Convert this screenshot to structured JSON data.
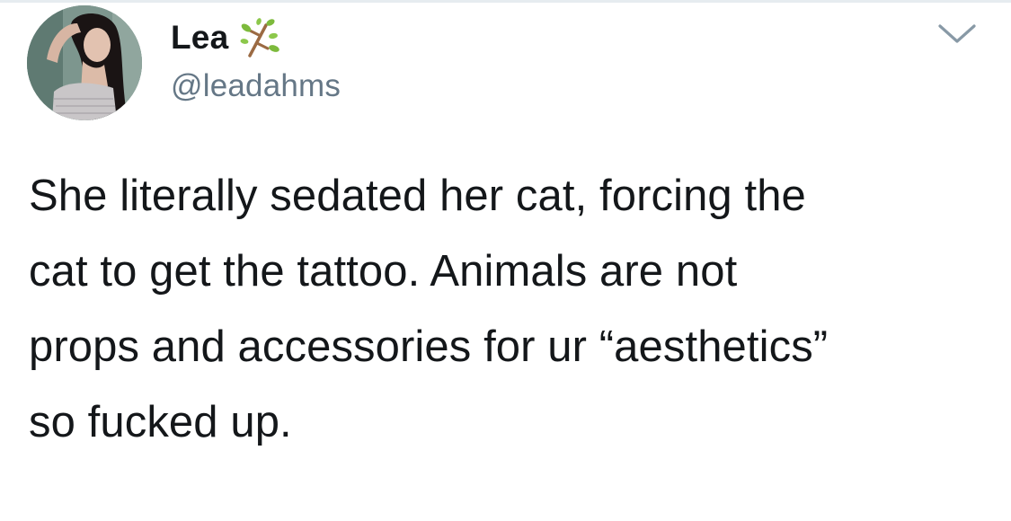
{
  "user": {
    "display_name": "Lea",
    "handle": "@leadahms",
    "name_emoji": "herb-icon"
  },
  "tweet": {
    "text": "She literally sedated her cat, forcing the\ncat to get the tattoo. Animals are not\nprops and accessories for ur “aesthetics”\nso fucked up."
  },
  "icons": {
    "menu": "chevron-down-icon"
  },
  "colors": {
    "text_primary": "#14171a",
    "text_secondary": "#657786",
    "divider": "#e6ecf0"
  }
}
